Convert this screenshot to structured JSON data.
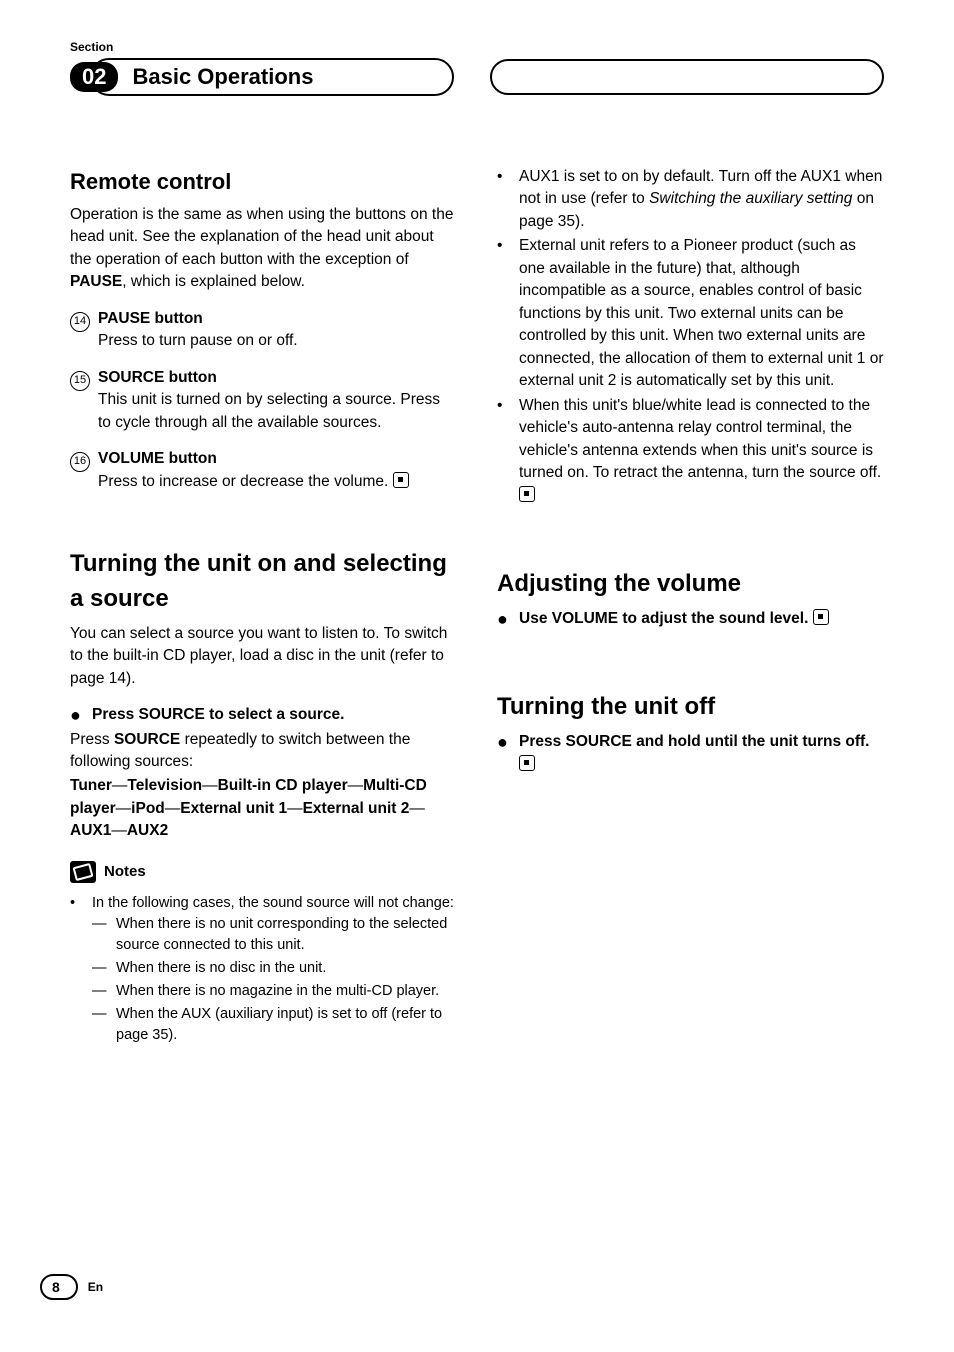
{
  "header": {
    "sectionLabel": "Section",
    "chapterNum": "02",
    "chapterTitle": "Basic Operations"
  },
  "col1": {
    "remote": {
      "title": "Remote control",
      "intro_1": "Operation is the same as when using the buttons on the head unit. See the explanation of the head unit about the operation of each button with the exception of ",
      "intro_bold": "PAUSE",
      "intro_2": ", which is explained below.",
      "items": [
        {
          "num": "14",
          "title": "PAUSE button",
          "desc": "Press to turn pause on or off."
        },
        {
          "num": "15",
          "title": "SOURCE button",
          "desc": "This unit is turned on by selecting a source. Press to cycle through all the available sources."
        },
        {
          "num": "16",
          "title": "VOLUME button",
          "desc": "Press to increase or decrease the volume."
        }
      ]
    },
    "turnOn": {
      "title": "Turning the unit on and selecting a source",
      "intro": "You can select a source you want to listen to. To switch to the built-in CD player, load a disc in the unit (refer to page 14).",
      "bulletBold": "Press SOURCE to select a source.",
      "press_1": "Press ",
      "press_bold": "SOURCE",
      "press_2": " repeatedly to switch between the following sources:",
      "seq_parts": [
        "Tuner",
        "Television",
        "Built-in CD player",
        "Multi-CD player",
        "iPod",
        "External unit 1",
        "External unit 2",
        "AUX1",
        "AUX2"
      ],
      "notesTitle": "Notes",
      "notes": {
        "n1": "In the following cases, the sound source will not change:",
        "subs": [
          "When there is no unit corresponding to the selected source connected to this unit.",
          "When there is no disc in the unit.",
          "When there is no magazine in the multi-CD player.",
          "When the AUX (auxiliary input) is set to off (refer to page 35)."
        ]
      }
    }
  },
  "col2": {
    "bullets": [
      {
        "pre": "AUX1 is set to on by default. Turn off the AUX1 when not in use (refer to ",
        "it": "Switching the auxiliary setting",
        "post": " on page 35)."
      },
      {
        "text": "External unit refers to a Pioneer product (such as one available in the future) that, although incompatible as a source, enables control of basic functions by this unit. Two external units can be controlled by this unit. When two external units are connected, the allocation of them to external unit 1 or external unit 2 is automatically set by this unit."
      },
      {
        "text": "When this unit's blue/white lead is connected to the vehicle's auto-antenna relay control terminal, the vehicle's antenna extends when this unit's source is turned on. To retract the antenna, turn the source off.",
        "end": true
      }
    ],
    "adjVol": {
      "title": "Adjusting the volume",
      "bullet": "Use VOLUME to adjust the sound level."
    },
    "turnOff": {
      "title": "Turning the unit off",
      "bullet": "Press SOURCE and hold until the unit turns off."
    }
  },
  "footer": {
    "pageNum": "8",
    "lang": "En"
  }
}
